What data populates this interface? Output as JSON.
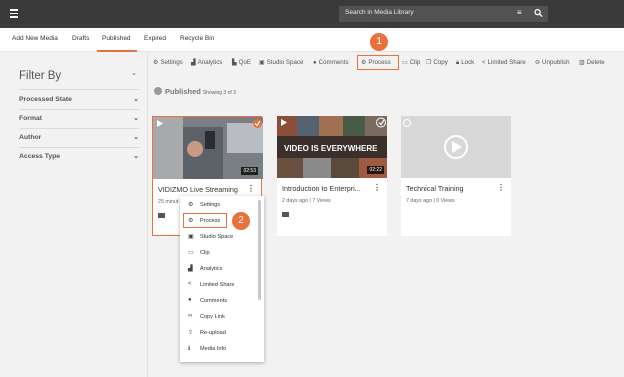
{
  "header": {
    "search_placeholder": "Search in Media Library"
  },
  "tabs": [
    "Add New Media",
    "Drafts",
    "Published",
    "Expired",
    "Recycle Bin"
  ],
  "active_tab": "Published",
  "sidebar": {
    "title": "Filter By",
    "filters": [
      "Processed State",
      "Format",
      "Author",
      "Access Type"
    ]
  },
  "toolbar": [
    "Settings",
    "Analytics",
    "QoE",
    "Studio Space",
    "Comments",
    "Process",
    "Clip",
    "Copy",
    "Lock",
    "Limited Share",
    "Unpublish",
    "Delete"
  ],
  "callouts": [
    "1",
    "2"
  ],
  "published": {
    "label": "Published",
    "count": "Showing 3 of 3"
  },
  "cards": [
    {
      "title": "VIDIZMO Live Streaming",
      "meta": "25 minut",
      "duration": "02:53",
      "thumb_text": ""
    },
    {
      "title": "Introduction to Enterpri...",
      "meta": "2 days ago | 7 Views",
      "duration": "02:22",
      "thumb_text": "VIDEO IS EVERYWHERE"
    },
    {
      "title": "Technical Training",
      "meta": "7 days ago | 0 Views",
      "duration": "",
      "thumb_text": ""
    }
  ],
  "menu": [
    "Settings",
    "Process",
    "Studio Space",
    "Clip",
    "Analytics",
    "Limited Share",
    "Comments",
    "Copy Link",
    "Re-upload",
    "Media Info"
  ],
  "colors": {
    "accent": "#e8713c",
    "topbar": "#3a3a3a"
  }
}
